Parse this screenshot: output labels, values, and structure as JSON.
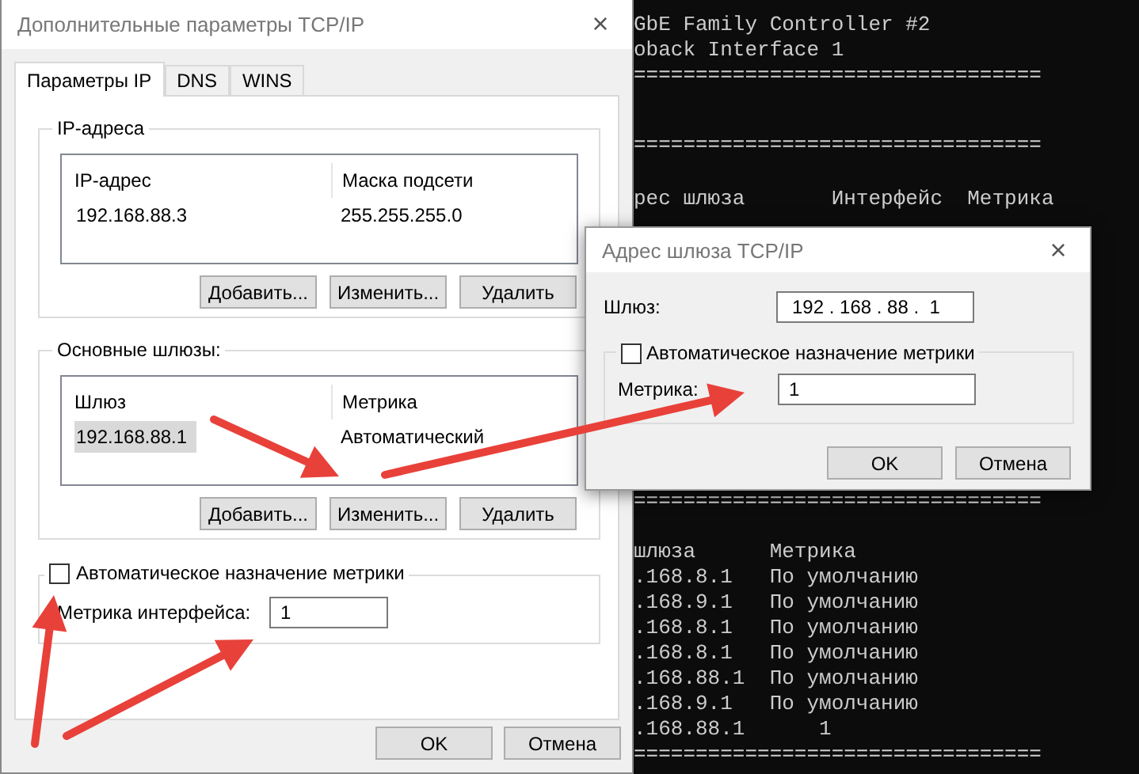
{
  "console": {
    "blocks": [
      {
        "lines": [
          "GbE Family Controller #2",
          "oback Interface 1",
          "================================="
        ]
      },
      {
        "lines": [
          "================================="
        ]
      },
      {
        "lines": [
          "рес шлюза       Интерфейс  Метрика"
        ]
      },
      {
        "lines": [
          "================================="
        ]
      },
      {
        "lines": [
          "шлюза      Метрика",
          ".168.8.1   По умолчанию",
          ".168.9.1   По умолчанию",
          ".168.8.1   По умолчанию",
          ".168.8.1   По умолчанию",
          ".168.88.1  По умолчанию",
          ".168.9.1   По умолчанию",
          ".168.88.1      1",
          "================================="
        ]
      }
    ]
  },
  "main_dialog": {
    "title": "Дополнительные параметры TCP/IP",
    "close": "×",
    "tabs": [
      {
        "label": "Параметры IP",
        "selected": true
      },
      {
        "label": "DNS",
        "selected": false
      },
      {
        "label": "WINS",
        "selected": false
      }
    ],
    "ip_group": {
      "title": "IP-адреса",
      "columns": [
        "IP-адрес",
        "Маска подсети"
      ],
      "rows": [
        {
          "cells": [
            "192.168.88.3",
            "255.255.255.0"
          ],
          "selected": false
        }
      ],
      "buttons": [
        "Добавить...",
        "Изменить...",
        "Удалить"
      ]
    },
    "gateway_group": {
      "title": "Основные шлюзы:",
      "columns": [
        "Шлюз",
        "Метрика"
      ],
      "rows": [
        {
          "cells": [
            "192.168.88.1",
            "Автоматический"
          ],
          "selected": true
        }
      ],
      "buttons": [
        "Добавить...",
        "Изменить...",
        "Удалить"
      ]
    },
    "auto_metric": {
      "label": "Автоматическое назначение метрики",
      "checked": false
    },
    "metric": {
      "label": "Метрика интерфейса:",
      "value": "1"
    },
    "buttons": [
      "OK",
      "Отмена"
    ]
  },
  "gateway_dialog": {
    "title": "Адрес шлюза TCP/IP",
    "close": "×",
    "gateway": {
      "label": "Шлюз:",
      "value": "192 . 168 . 88 .  1"
    },
    "auto_metric": {
      "label": "Автоматическое назначение метрики",
      "checked": false
    },
    "metric": {
      "label": "Метрика:",
      "value": "1"
    },
    "buttons": [
      "OK",
      "Отмена"
    ]
  }
}
